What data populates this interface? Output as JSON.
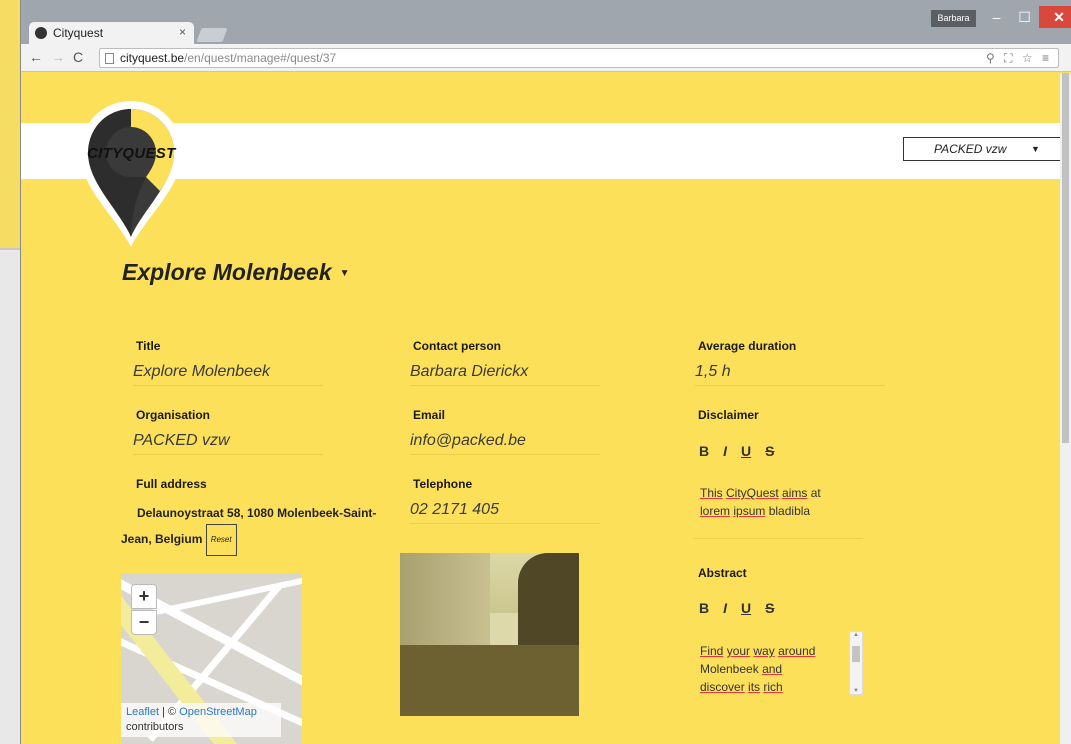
{
  "browser": {
    "tab_title": "Cityquest",
    "tab_close": "×",
    "user": "Barbara",
    "url_host": "cityquest.be",
    "url_path": "/en/quest/manage#/quest/37",
    "window_buttons": {
      "minimize": "–",
      "maximize": "☐",
      "close": "✕"
    },
    "nav": {
      "back": "←",
      "forward": "→",
      "reload": "C"
    },
    "url_icons": "⚲ ⛶ ☆ ≡"
  },
  "header": {
    "logo_text": "CITYQUEST",
    "org_select": "PACKED vzw",
    "org_caret": "▼"
  },
  "quest": {
    "title": "Explore Molenbeek",
    "caret": "▼"
  },
  "fields": {
    "title_label": "Title",
    "title_value": "Explore Molenbeek",
    "organisation_label": "Organisation",
    "organisation_value": "PACKED vzw",
    "address_label": "Full address",
    "address_value": "Delaunoystraat 58, 1080 Molenbeek-Saint-Jean, Belgium",
    "reset_label": "Reset",
    "contact_label": "Contact person",
    "contact_value": "Barbara Dierickx",
    "email_label": "Email",
    "email_value": "info@packed.be",
    "telephone_label": "Telephone",
    "telephone_value": "02 2171 405",
    "duration_label": "Average duration",
    "duration_value": "1,5 h",
    "disclaimer_label": "Disclaimer",
    "abstract_label": "Abstract"
  },
  "formatting": {
    "bold": "B",
    "italic": "I",
    "underline": "U",
    "strike": "S"
  },
  "disclaimer_text": {
    "w1": "This",
    "w2": "CityQuest",
    "w3": "aims",
    "w4": "at",
    "w5": "lorem",
    "w6": "ipsum",
    "w7": "bladibla"
  },
  "abstract_text": {
    "w1": "Find",
    "w2": "your",
    "w3": "way",
    "w4": "around",
    "w5": "Molenbeek",
    "w6": "and",
    "w7": "discover",
    "w8": "its",
    "w9": "rich"
  },
  "map": {
    "zoom_in": "+",
    "zoom_out": "−",
    "attr_leaflet": "Leaflet",
    "attr_sep": " | © ",
    "attr_osm": "OpenStreetMap",
    "attr_contrib": "contributors"
  },
  "colors": {
    "page_bg": "#fde05a",
    "close_button": "#d9473d",
    "link": "#2b78c3"
  }
}
